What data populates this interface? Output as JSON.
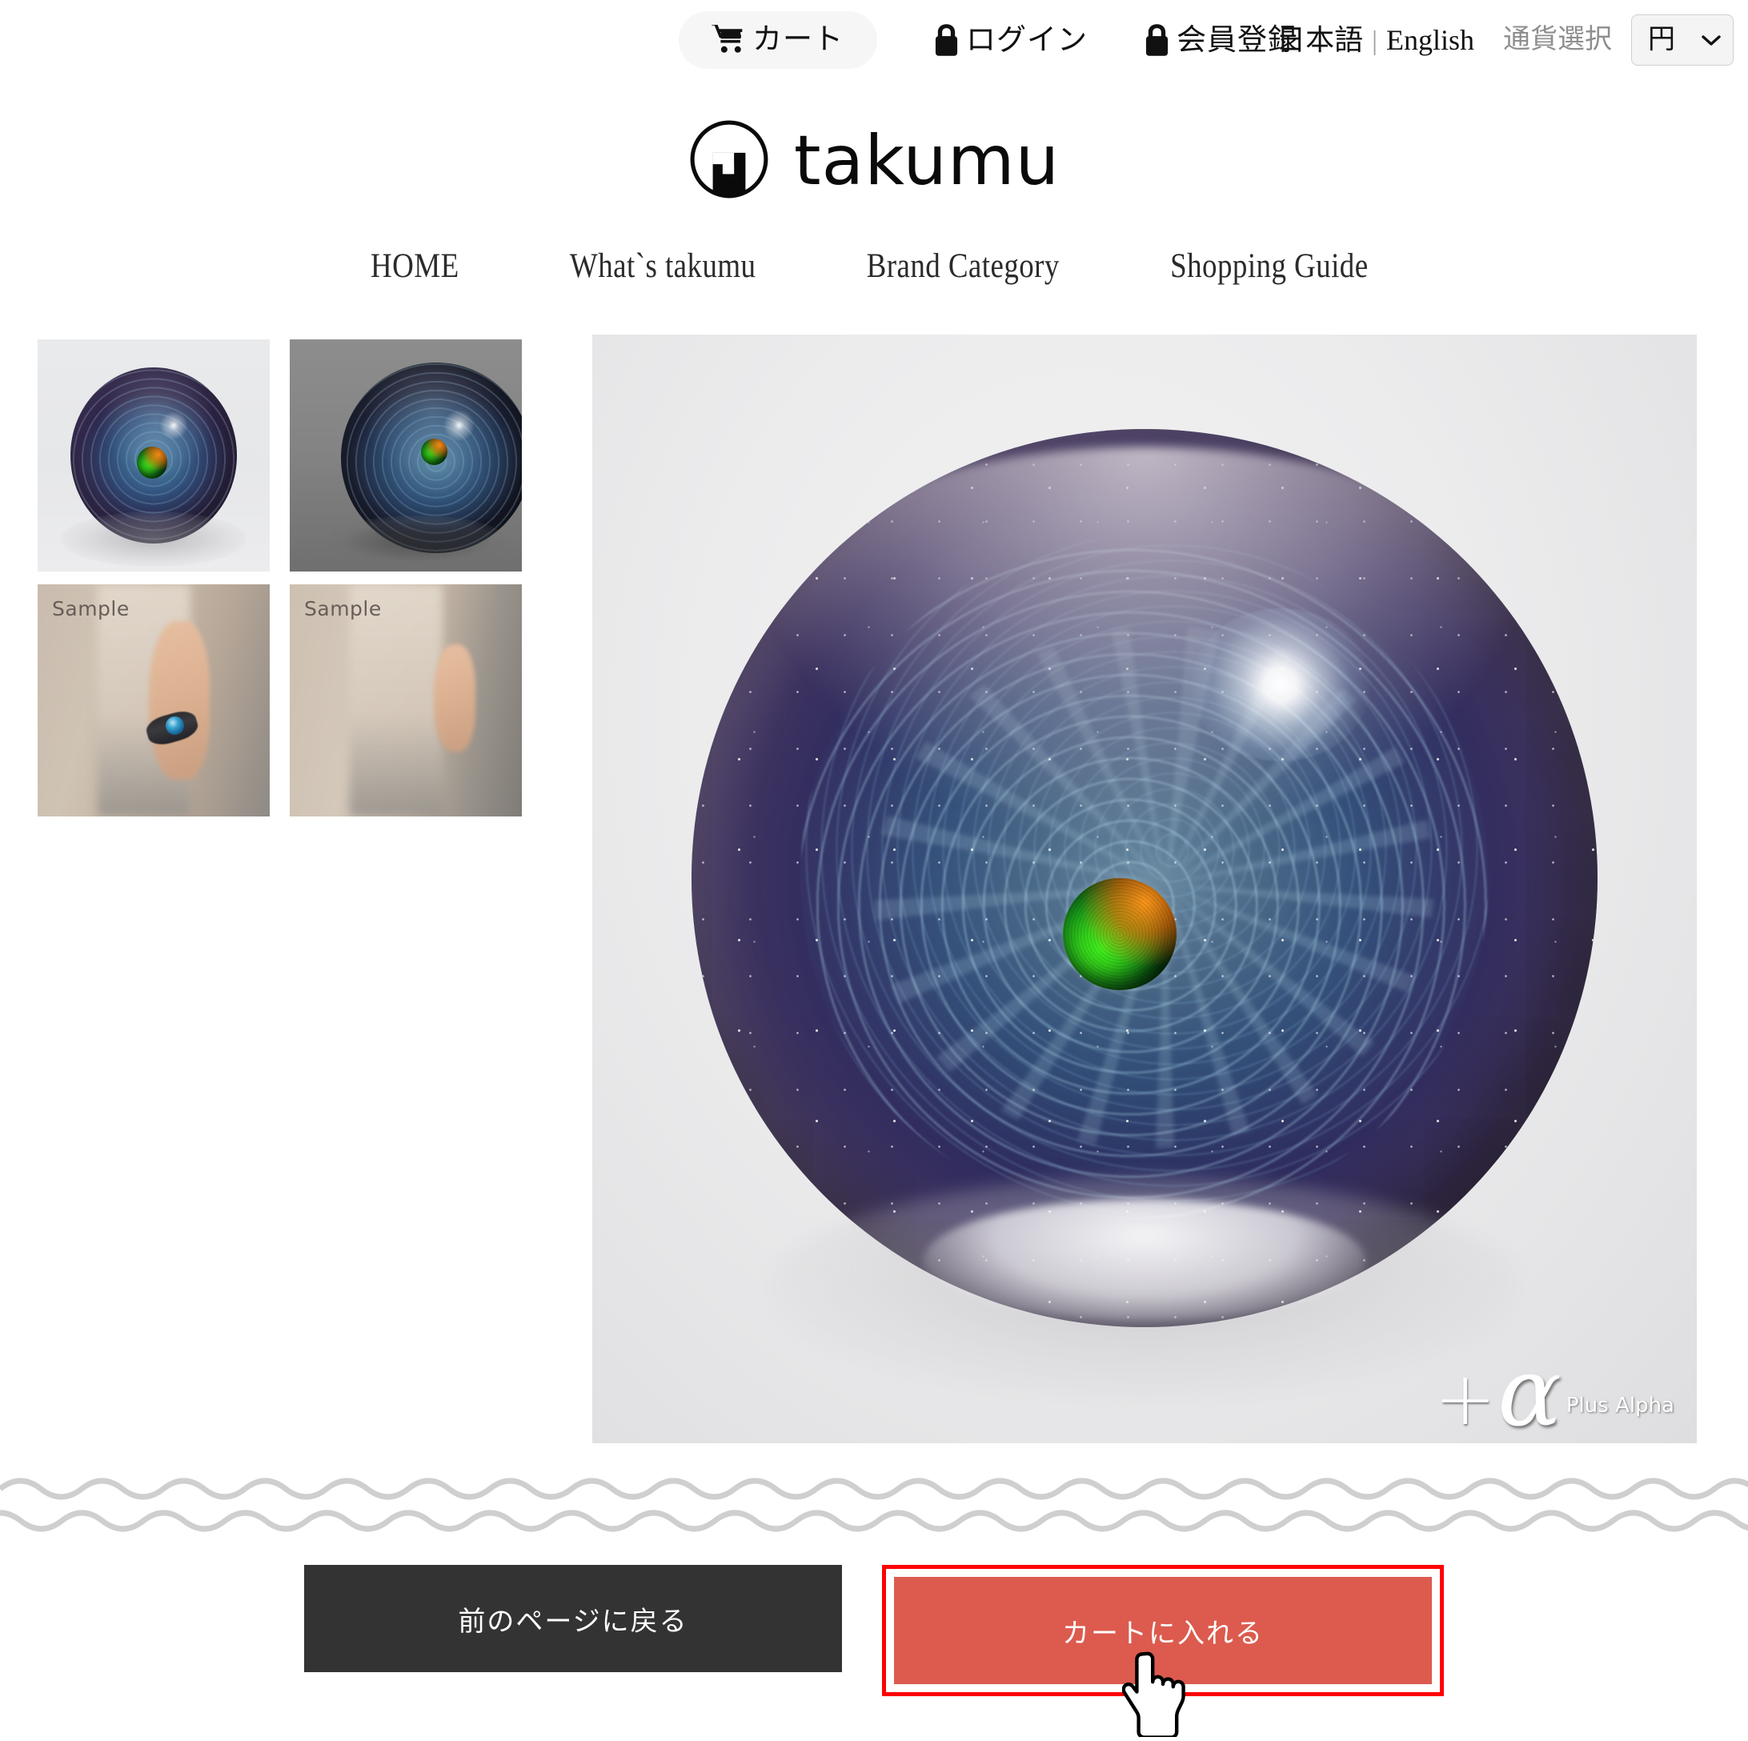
{
  "utility": {
    "cart": {
      "label": "カート",
      "icon": "shopping-cart-icon"
    },
    "login": {
      "label": "ログイン",
      "icon": "lock-icon"
    },
    "register": {
      "label": "会員登録",
      "icon": "lock-icon"
    },
    "lang_ja": "日本語",
    "lang_sep": "|",
    "lang_en": "English",
    "currency_label": "通貨選択",
    "currency_value": "円",
    "currency_options": [
      "円"
    ]
  },
  "brand": {
    "logo_text": "takumu",
    "logo_mark": "takumu-logo-mark"
  },
  "nav": {
    "items": [
      {
        "label": "HOME"
      },
      {
        "label": "What`s takumu"
      },
      {
        "label": "Brand Category"
      },
      {
        "label": "Shopping Guide"
      }
    ]
  },
  "gallery": {
    "thumbnails": [
      {
        "alt": "glass-orb-front-light",
        "tag": ""
      },
      {
        "alt": "glass-orb-angle-dark",
        "tag": ""
      },
      {
        "alt": "model-wearing-bracelet-arm",
        "tag": "Sample"
      },
      {
        "alt": "model-wearing-bracelet-side",
        "tag": "Sample"
      }
    ],
    "main_image": {
      "alt": "glass-orb-galaxy-opal-core",
      "watermark_plus": "+",
      "watermark_alpha": "α",
      "watermark_sub": "Plus Alpha"
    }
  },
  "actions": {
    "back_label": "前のページに戻る",
    "add_to_cart_label": "カートに入れる"
  },
  "colors": {
    "cart_button": "#dc5b4e",
    "back_button": "#333333",
    "highlight_border": "#ff0000",
    "wave": "#cfcfcf",
    "pill_bg": "#f6f6f6"
  },
  "cursor": {
    "type": "pointing-hand-cursor"
  }
}
